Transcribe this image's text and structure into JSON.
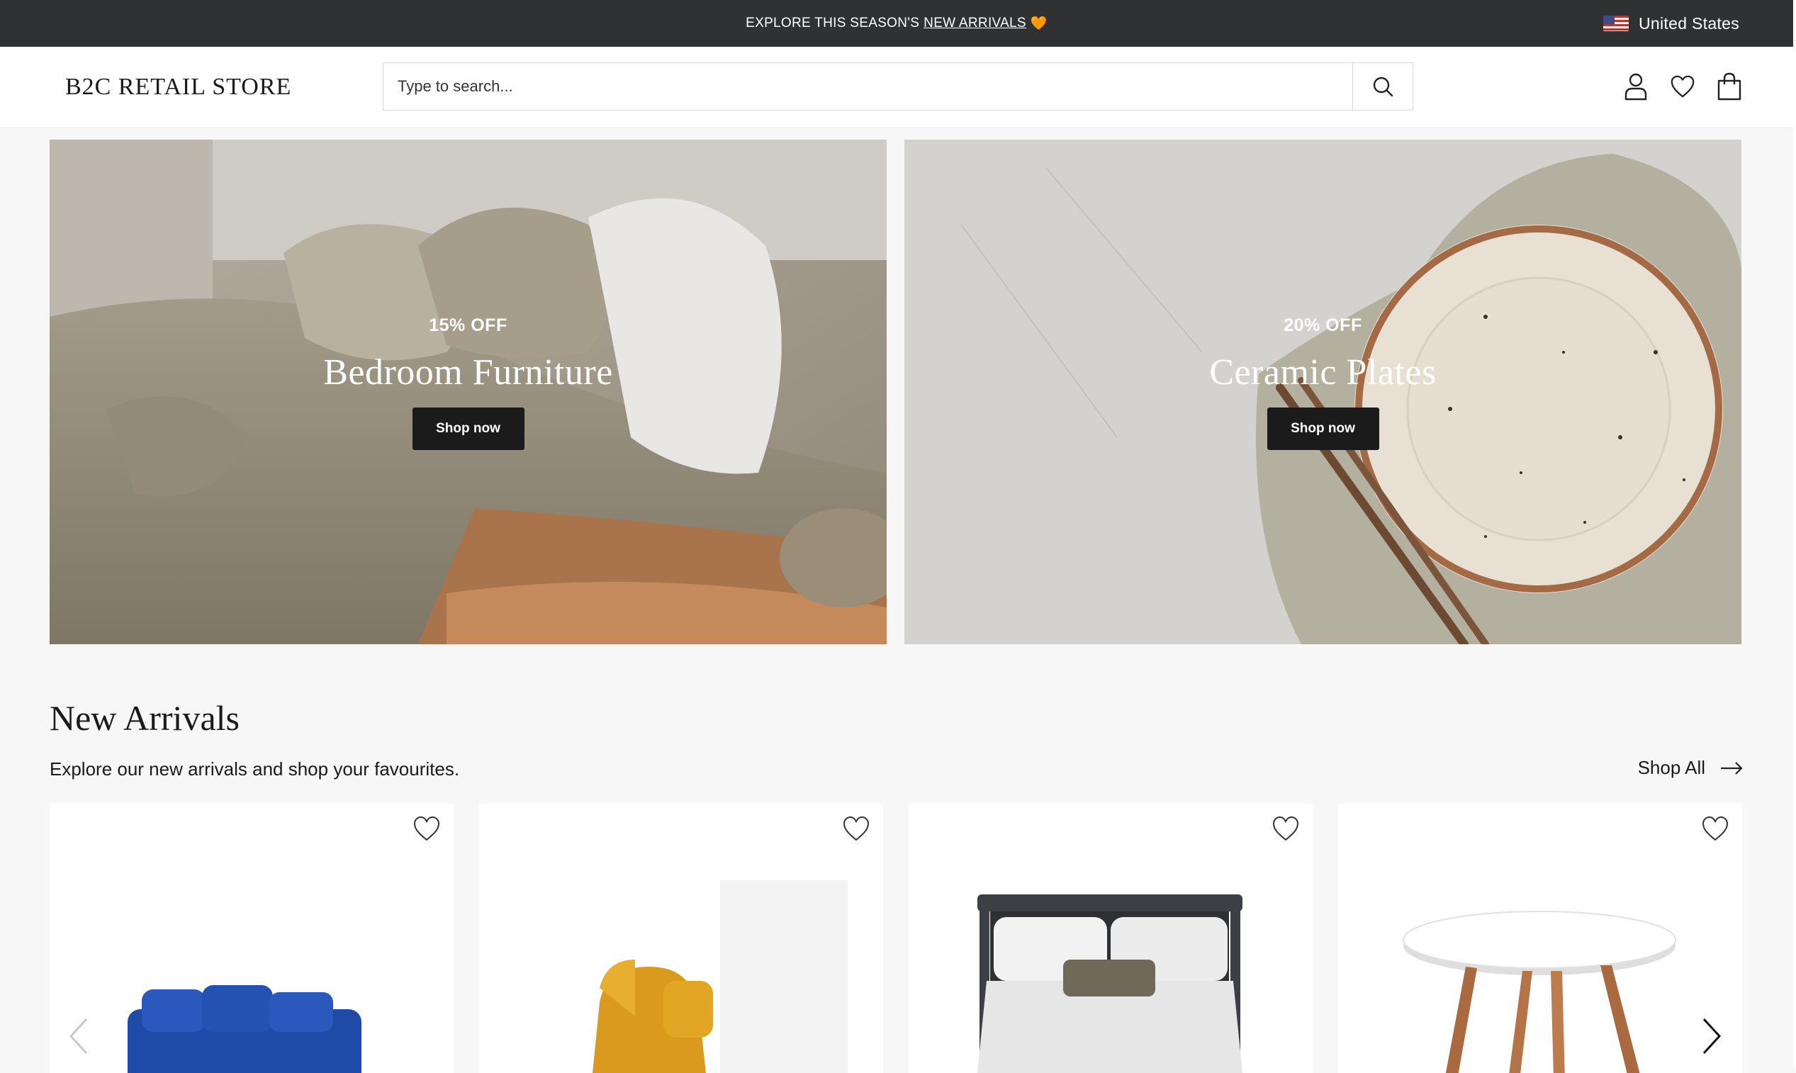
{
  "announcement": {
    "prefix": "EXPLORE THIS SEASON'S",
    "link": "NEW ARRIVALS",
    "emoji": "🧡"
  },
  "country": {
    "label": "United States",
    "icon": "us-flag-icon"
  },
  "header": {
    "logo": "B2C RETAIL STORE",
    "search_placeholder": "Type to search...",
    "icons": [
      "user-icon",
      "heart-icon",
      "shopping-bag-icon"
    ]
  },
  "banners": [
    {
      "discount": "15% OFF",
      "title": "Bedroom Furniture",
      "button": "Shop now"
    },
    {
      "discount": "20% OFF",
      "title": "Ceramic Plates",
      "button": "Shop now"
    }
  ],
  "new_arrivals": {
    "title": "New Arrivals",
    "subtitle": "Explore our new arrivals and shop your favourites.",
    "shop_all": "Shop All",
    "products": [
      {
        "image": "blue-sofa"
      },
      {
        "image": "yellow-armchair"
      },
      {
        "image": "bed-with-pillows"
      },
      {
        "image": "white-round-table"
      }
    ]
  },
  "colors": {
    "topbar": "#2f3133",
    "button": "#1b1b1b",
    "background": "#f7f7f7"
  }
}
